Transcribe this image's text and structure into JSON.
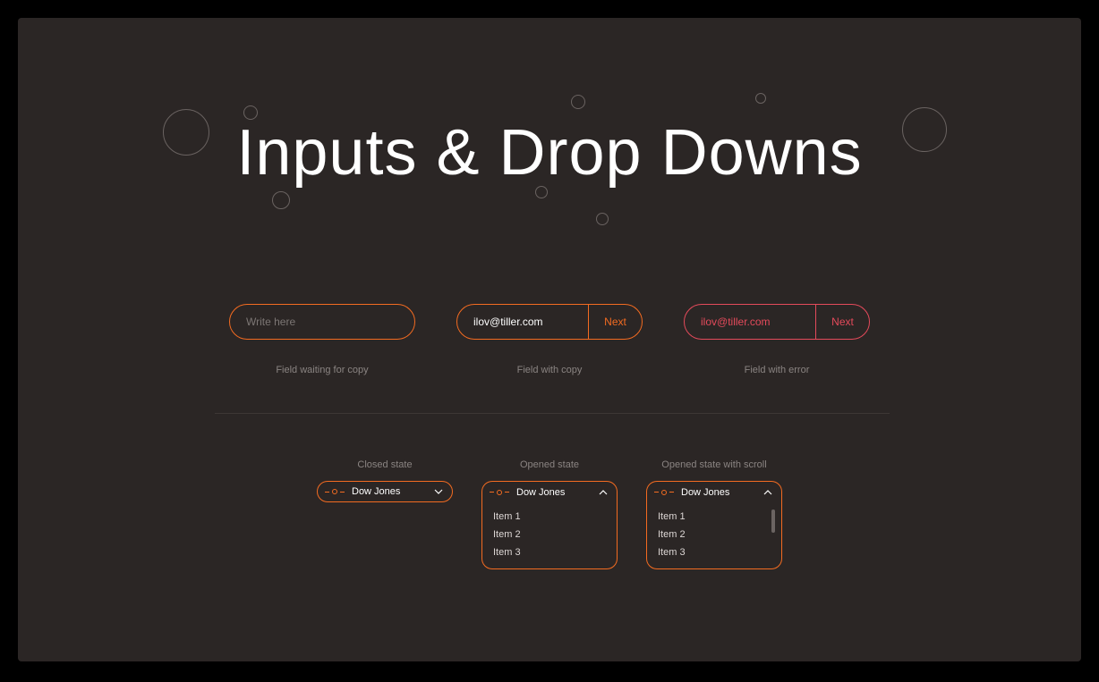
{
  "title": "Inputs & Drop Downs",
  "inputs": {
    "empty": {
      "placeholder": "Write here",
      "caption": "Field waiting for copy"
    },
    "filled": {
      "value": "ilov@tiller.com",
      "next_label": "Next",
      "caption": "Field with copy"
    },
    "error": {
      "value": "ilov@tiller.com",
      "next_label": "Next",
      "caption": "Field with error"
    }
  },
  "dropdowns": {
    "closed": {
      "caption": "Closed state",
      "selected": "Dow Jones"
    },
    "opened": {
      "caption": "Opened state",
      "selected": "Dow Jones",
      "items": [
        "Item 1",
        "Item 2",
        "Item 3"
      ]
    },
    "scroll": {
      "caption": "Opened state with scroll",
      "selected": "Dow Jones",
      "items": [
        "Item 1",
        "Item 2",
        "Item 3"
      ]
    }
  },
  "colors": {
    "accent": "#f36b21",
    "error": "#e44a5b",
    "bg": "#2b2625"
  }
}
